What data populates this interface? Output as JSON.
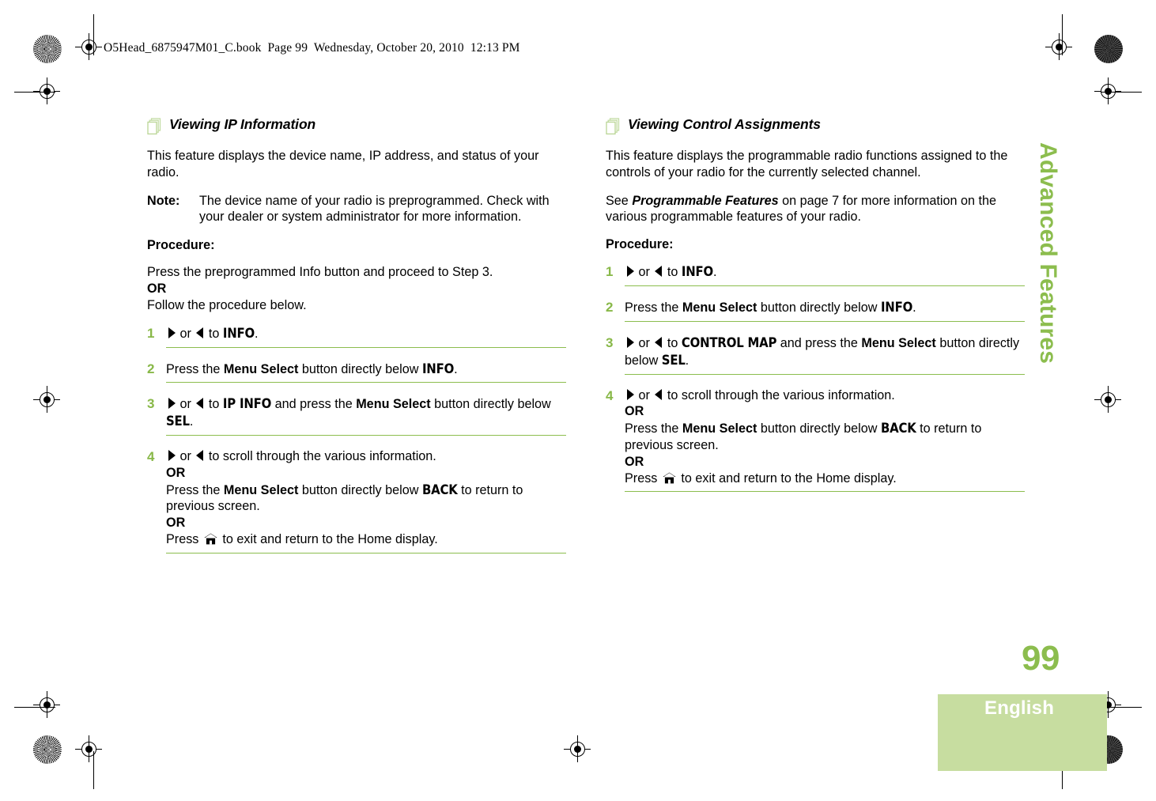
{
  "header": {
    "file_slug": "O5Head_6875947M01_C.book  Page 99  Wednesday, October 20, 2010  12:13 PM"
  },
  "sidebar": {
    "chapter_tab": "Advanced Features",
    "accent_color": "#8cbd4e"
  },
  "footer": {
    "page_number": "99",
    "language": "English",
    "language_block_color": "#c7dda0"
  },
  "icons": {
    "section": "pages-stack-icon",
    "home": "home-icon",
    "nav_right": "triangle-right-icon",
    "nav_left": "triangle-left-icon"
  },
  "left_column": {
    "heading": "Viewing IP Information",
    "intro": "This feature displays the device name, IP address, and status of your radio.",
    "note": {
      "label": "Note:",
      "text": "The device name of your radio is preprogrammed. Check with your dealer or system administrator for more information."
    },
    "procedure_label": "Procedure:",
    "lead_line1": "Press the preprogrammed Info button and proceed to Step 3.",
    "lead_or": "OR",
    "lead_line2": "Follow the procedure below.",
    "steps": [
      {
        "num": "1",
        "parts": [
          {
            "t": "tri-r"
          },
          {
            "t": "text",
            "v": " or "
          },
          {
            "t": "tri-l"
          },
          {
            "t": "text",
            "v": " to "
          },
          {
            "t": "disp",
            "v": "INFO"
          },
          {
            "t": "text",
            "v": "."
          }
        ]
      },
      {
        "num": "2",
        "parts": [
          {
            "t": "text",
            "v": "Press the "
          },
          {
            "t": "bold",
            "v": "Menu Select"
          },
          {
            "t": "text",
            "v": " button directly below "
          },
          {
            "t": "disp",
            "v": "INFO"
          },
          {
            "t": "text",
            "v": "."
          }
        ]
      },
      {
        "num": "3",
        "parts": [
          {
            "t": "tri-r"
          },
          {
            "t": "text",
            "v": " or "
          },
          {
            "t": "tri-l"
          },
          {
            "t": "text",
            "v": " to "
          },
          {
            "t": "disp",
            "v": "IP INFO"
          },
          {
            "t": "text",
            "v": " and press the "
          },
          {
            "t": "bold",
            "v": "Menu Select"
          },
          {
            "t": "text",
            "v": " button directly below "
          },
          {
            "t": "disp",
            "v": "SEL"
          },
          {
            "t": "text",
            "v": "."
          }
        ]
      },
      {
        "num": "4",
        "parts": [
          {
            "t": "tri-r"
          },
          {
            "t": "text",
            "v": " or "
          },
          {
            "t": "tri-l"
          },
          {
            "t": "text",
            "v": " to scroll through the various information."
          },
          {
            "t": "br"
          },
          {
            "t": "bold",
            "v": "OR"
          },
          {
            "t": "br"
          },
          {
            "t": "text",
            "v": "Press the "
          },
          {
            "t": "bold",
            "v": "Menu Select"
          },
          {
            "t": "text",
            "v": " button directly below "
          },
          {
            "t": "disp",
            "v": "BACK"
          },
          {
            "t": "text",
            "v": " to return to previous screen."
          },
          {
            "t": "br"
          },
          {
            "t": "bold",
            "v": "OR"
          },
          {
            "t": "gap"
          },
          {
            "t": "text",
            "v": "Press "
          },
          {
            "t": "home"
          },
          {
            "t": "text",
            "v": " to exit and return to the Home display."
          }
        ]
      }
    ]
  },
  "right_column": {
    "heading": "Viewing Control Assignments",
    "intro": "This feature displays the programmable radio functions assigned to the controls of your radio for the currently selected channel.",
    "cross_ref": {
      "prefix": "See ",
      "emph": "Programmable Features",
      "suffix": " on page 7 for more information on the various programmable features of your radio."
    },
    "procedure_label": "Procedure:",
    "steps": [
      {
        "num": "1",
        "parts": [
          {
            "t": "tri-r"
          },
          {
            "t": "text",
            "v": " or "
          },
          {
            "t": "tri-l"
          },
          {
            "t": "text",
            "v": " to "
          },
          {
            "t": "disp",
            "v": "INFO"
          },
          {
            "t": "text",
            "v": "."
          }
        ]
      },
      {
        "num": "2",
        "parts": [
          {
            "t": "text",
            "v": "Press the "
          },
          {
            "t": "bold",
            "v": "Menu Select"
          },
          {
            "t": "text",
            "v": " button directly below "
          },
          {
            "t": "disp",
            "v": "INFO"
          },
          {
            "t": "text",
            "v": "."
          }
        ]
      },
      {
        "num": "3",
        "parts": [
          {
            "t": "tri-r"
          },
          {
            "t": "text",
            "v": " or "
          },
          {
            "t": "tri-l"
          },
          {
            "t": "text",
            "v": " to "
          },
          {
            "t": "disp",
            "v": "CONTROL MAP"
          },
          {
            "t": "text",
            "v": " and press the "
          },
          {
            "t": "bold",
            "v": "Menu Select"
          },
          {
            "t": "text",
            "v": " button directly below "
          },
          {
            "t": "disp",
            "v": "SEL"
          },
          {
            "t": "text",
            "v": "."
          }
        ]
      },
      {
        "num": "4",
        "parts": [
          {
            "t": "tri-r"
          },
          {
            "t": "text",
            "v": " or "
          },
          {
            "t": "tri-l"
          },
          {
            "t": "text",
            "v": " to scroll through the various information."
          },
          {
            "t": "br"
          },
          {
            "t": "bold",
            "v": "OR"
          },
          {
            "t": "br"
          },
          {
            "t": "text",
            "v": "Press the "
          },
          {
            "t": "bold",
            "v": "Menu Select"
          },
          {
            "t": "text",
            "v": " button directly below "
          },
          {
            "t": "disp",
            "v": "BACK"
          },
          {
            "t": "text",
            "v": " to return to previous screen."
          },
          {
            "t": "br"
          },
          {
            "t": "bold",
            "v": "OR"
          },
          {
            "t": "gap"
          },
          {
            "t": "text",
            "v": "Press "
          },
          {
            "t": "home"
          },
          {
            "t": "text",
            "v": " to exit and return to the Home display."
          }
        ]
      }
    ]
  }
}
